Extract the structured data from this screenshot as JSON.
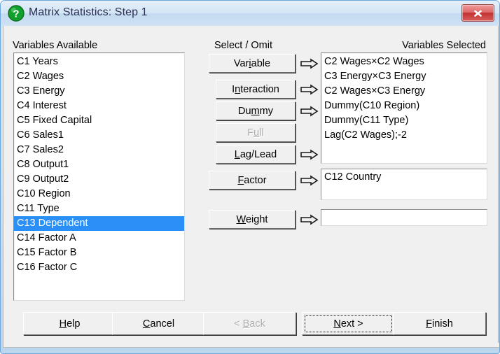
{
  "window": {
    "title": "Matrix Statistics: Step 1",
    "icon": "question-mark-icon",
    "close_label": "×",
    "accent_title_color": "#2b2f52",
    "close_button_color": "#c23232",
    "selection_color": "#2a8ff7",
    "dialog_background": "#f0f0f0"
  },
  "left_panel": {
    "label": "Variables Available",
    "items": [
      "C1 Years",
      "C2 Wages",
      "C3 Energy",
      "C4 Interest",
      "C5 Fixed Capital",
      "C6 Sales1",
      "C7 Sales2",
      "C8 Output1",
      "C9 Output2",
      "C10 Region",
      "C11 Type",
      "C13 Dependent",
      "C14 Factor A",
      "C15 Factor B",
      "C16 Factor C"
    ],
    "selected_index": 11
  },
  "center_panel": {
    "label": "Select / Omit",
    "buttons": [
      {
        "name": "variable",
        "label": "Variable",
        "accel_index": 3,
        "disabled": false,
        "has_arrow": true
      },
      {
        "name": "interaction",
        "label": "Interaction",
        "accel_index": 1,
        "disabled": false,
        "has_arrow": true
      },
      {
        "name": "dummy",
        "label": "Dummy",
        "accel_index": 2,
        "disabled": false,
        "has_arrow": true
      },
      {
        "name": "full",
        "label": "Full",
        "accel_index": 1,
        "disabled": true,
        "has_arrow": false
      },
      {
        "name": "lag-lead",
        "label": "Lag/Lead",
        "accel_index": 0,
        "disabled": false,
        "has_arrow": true
      },
      {
        "name": "factor",
        "label": "Factor",
        "accel_index": 0,
        "disabled": false,
        "has_arrow": true
      },
      {
        "name": "weight",
        "label": "Weight",
        "accel_index": 0,
        "disabled": false,
        "has_arrow": true
      }
    ]
  },
  "right_panel": {
    "label": "Variables Selected",
    "items": [
      "C2 Wages×C2 Wages",
      "C3 Energy×C3 Energy",
      "C2 Wages×C3 Energy",
      "Dummy(C10 Region)",
      "Dummy(C11 Type)",
      "Lag(C2 Wages);-2"
    ],
    "factor_value": "C12 Country",
    "weight_value": ""
  },
  "footer": {
    "buttons": [
      {
        "name": "help",
        "label": "Help",
        "accel_index": 0,
        "disabled": false,
        "focused": false
      },
      {
        "name": "cancel",
        "label": "Cancel",
        "accel_index": 0,
        "disabled": false,
        "focused": false
      },
      {
        "name": "back",
        "label": "< Back",
        "accel_index": 2,
        "disabled": true,
        "focused": false
      },
      {
        "name": "next",
        "label": "Next >",
        "accel_index": 0,
        "disabled": false,
        "focused": true
      },
      {
        "name": "finish",
        "label": "Finish",
        "accel_index": 0,
        "disabled": false,
        "focused": false
      }
    ]
  }
}
